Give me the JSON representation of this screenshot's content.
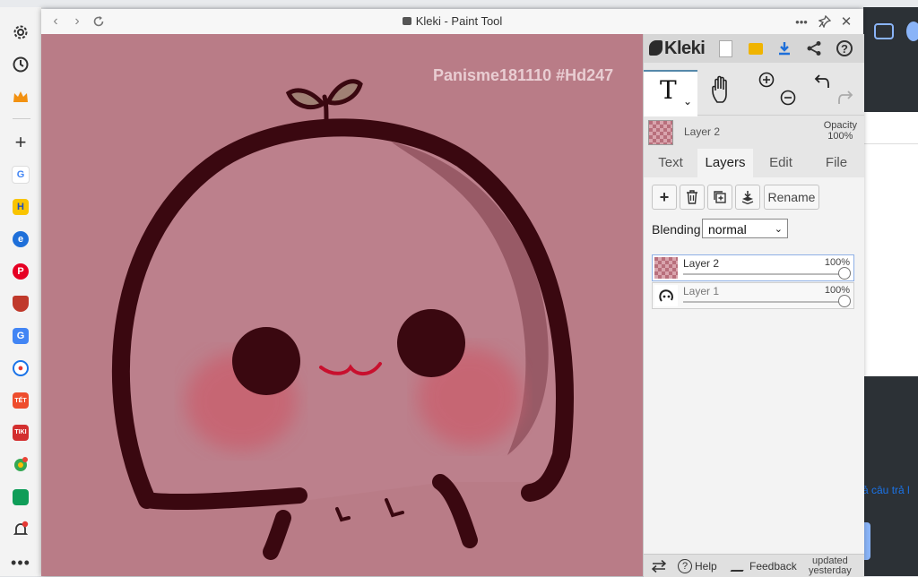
{
  "browser": {
    "window_title": "Kleki - Paint Tool",
    "sidebar_icons": [
      "gear-icon",
      "history-icon",
      "crown-icon",
      "plus-icon",
      "google-icon",
      "h-app-icon",
      "edge-app-icon",
      "pinterest-icon",
      "shield-app-icon",
      "translate-icon",
      "game-icon",
      "shopee-icon",
      "tiki-icon",
      "maps-icon",
      "sheets-icon",
      "bell-icon",
      "more-icon"
    ],
    "sidebar_labels": {
      "google": "G",
      "h": "H",
      "tet": "TẾT",
      "tiki": "TIKI"
    }
  },
  "canvas": {
    "watermark": "Panisme181110 #Hd247",
    "colors": {
      "background": "#b97c87",
      "outline": "#3a0810",
      "blush": "#c9606e",
      "mouth": "#c8102e"
    }
  },
  "panel": {
    "logo": "Kleki",
    "layer_bar": {
      "name": "Layer 2",
      "opacity_label": "Opacity",
      "opacity_value": "100%"
    },
    "tabs": [
      {
        "label": "Text",
        "active": false
      },
      {
        "label": "Layers",
        "active": true
      },
      {
        "label": "Edit",
        "active": false
      },
      {
        "label": "File",
        "active": false
      }
    ],
    "layer_buttons": {
      "rename": "Rename"
    },
    "blending": {
      "label": "Blending",
      "value": "normal"
    },
    "layers": [
      {
        "name": "Layer 2",
        "opacity": "100%",
        "level": 1.0,
        "active": true
      },
      {
        "name": "Layer 1",
        "opacity": "100%",
        "level": 1.0,
        "active": false
      }
    ],
    "footer": {
      "help": "Help",
      "feedback": "Feedback",
      "updated": "updated",
      "updated_when": "yesterday"
    }
  },
  "background_page": {
    "snippet": "ả câu trả l"
  }
}
